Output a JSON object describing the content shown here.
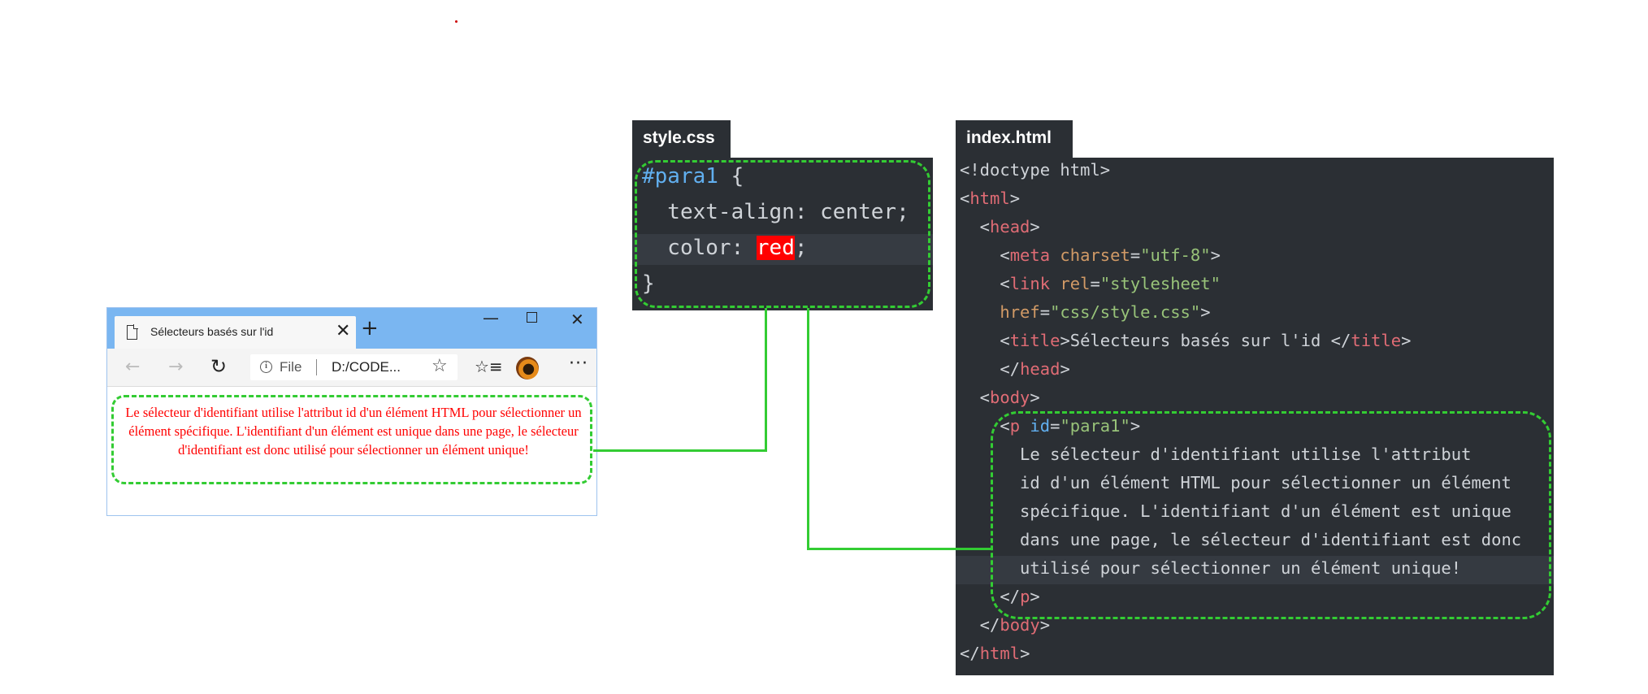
{
  "browser": {
    "tab_title": "Sélecteurs basés sur l'id",
    "tab_close": "✕",
    "new_tab": "+",
    "window_minimize": "—",
    "window_close": "✕",
    "back_icon": "←",
    "forward_icon": "→",
    "refresh_icon": "↻",
    "info_icon": "i",
    "address_label": "File",
    "address_url": "D:/CODE...",
    "star_icon": "☆",
    "favorites_icon": "☆≡",
    "more_icon": "···",
    "page_text": "Le sélecteur d'identifiant utilise l'attribut id d'un élément HTML pour sélectionner un élément spécifique. L'identifiant d'un élément est unique dans une page, le sélecteur d'identifiant est donc utilisé pour sélectionner un élément unique!"
  },
  "css_file": {
    "tab_label": "style.css",
    "lines": {
      "selector": "#para1",
      "open_brace": " {",
      "line2": "  text-align: center;",
      "line3_prop": "  color: ",
      "line3_value": "red",
      "line3_end": ";",
      "close_brace": "}"
    }
  },
  "html_file": {
    "tab_label": "index.html",
    "lines": {
      "l1": "<!doctype html>",
      "l2_open": "<",
      "l2_tag": "html",
      "l2_close": ">",
      "l3_indent": "  <",
      "l3_tag": "head",
      "l3_close": ">",
      "l4_indent": "    <",
      "l4_tag": "meta",
      "l4_attr": " charset",
      "l4_eq": "=",
      "l4_val": "\"utf-8\"",
      "l4_close": ">",
      "l5_indent": "    <",
      "l5_tag": "link",
      "l5_attr": " rel",
      "l5_eq": "=",
      "l5_val": "\"stylesheet\"",
      "l6_attr": "    href",
      "l6_eq": "=",
      "l6_val": "\"css/style.css\"",
      "l6_close": ">",
      "l7_indent": "    <",
      "l7_tag": "title",
      "l7_mid": ">Sélecteurs basés sur l'id </",
      "l7_tag2": "title",
      "l7_close": ">",
      "l8_indent": "    </",
      "l8_tag": "head",
      "l8_close": ">",
      "l9_indent": "  <",
      "l9_tag": "body",
      "l9_close": ">",
      "l10_indent": "    <",
      "l10_tag": "p",
      "l10_attr": " id",
      "l10_eq": "=",
      "l10_val": "\"para1\"",
      "l10_close": ">",
      "l11": "      Le sélecteur d'identifiant utilise l'attribut",
      "l12": "      id d'un élément HTML pour sélectionner un élément",
      "l13": "      spécifique. L'identifiant d'un élément est unique",
      "l14": "      dans une page, le sélecteur d'identifiant est donc",
      "l15": "      utilisé pour sélectionner un élément unique!",
      "l16_indent": "    </",
      "l16_tag": "p",
      "l16_close": ">",
      "l17_indent": "  </",
      "l17_tag": "body",
      "l17_close": ">",
      "l18_open": "</",
      "l18_tag": "html",
      "l18_close": ">"
    }
  },
  "colors": {
    "highlight_border": "#33cc33",
    "code_background": "#2b2f34",
    "page_text": "#ff0000",
    "browser_titlebar": "#7ab6f1"
  }
}
